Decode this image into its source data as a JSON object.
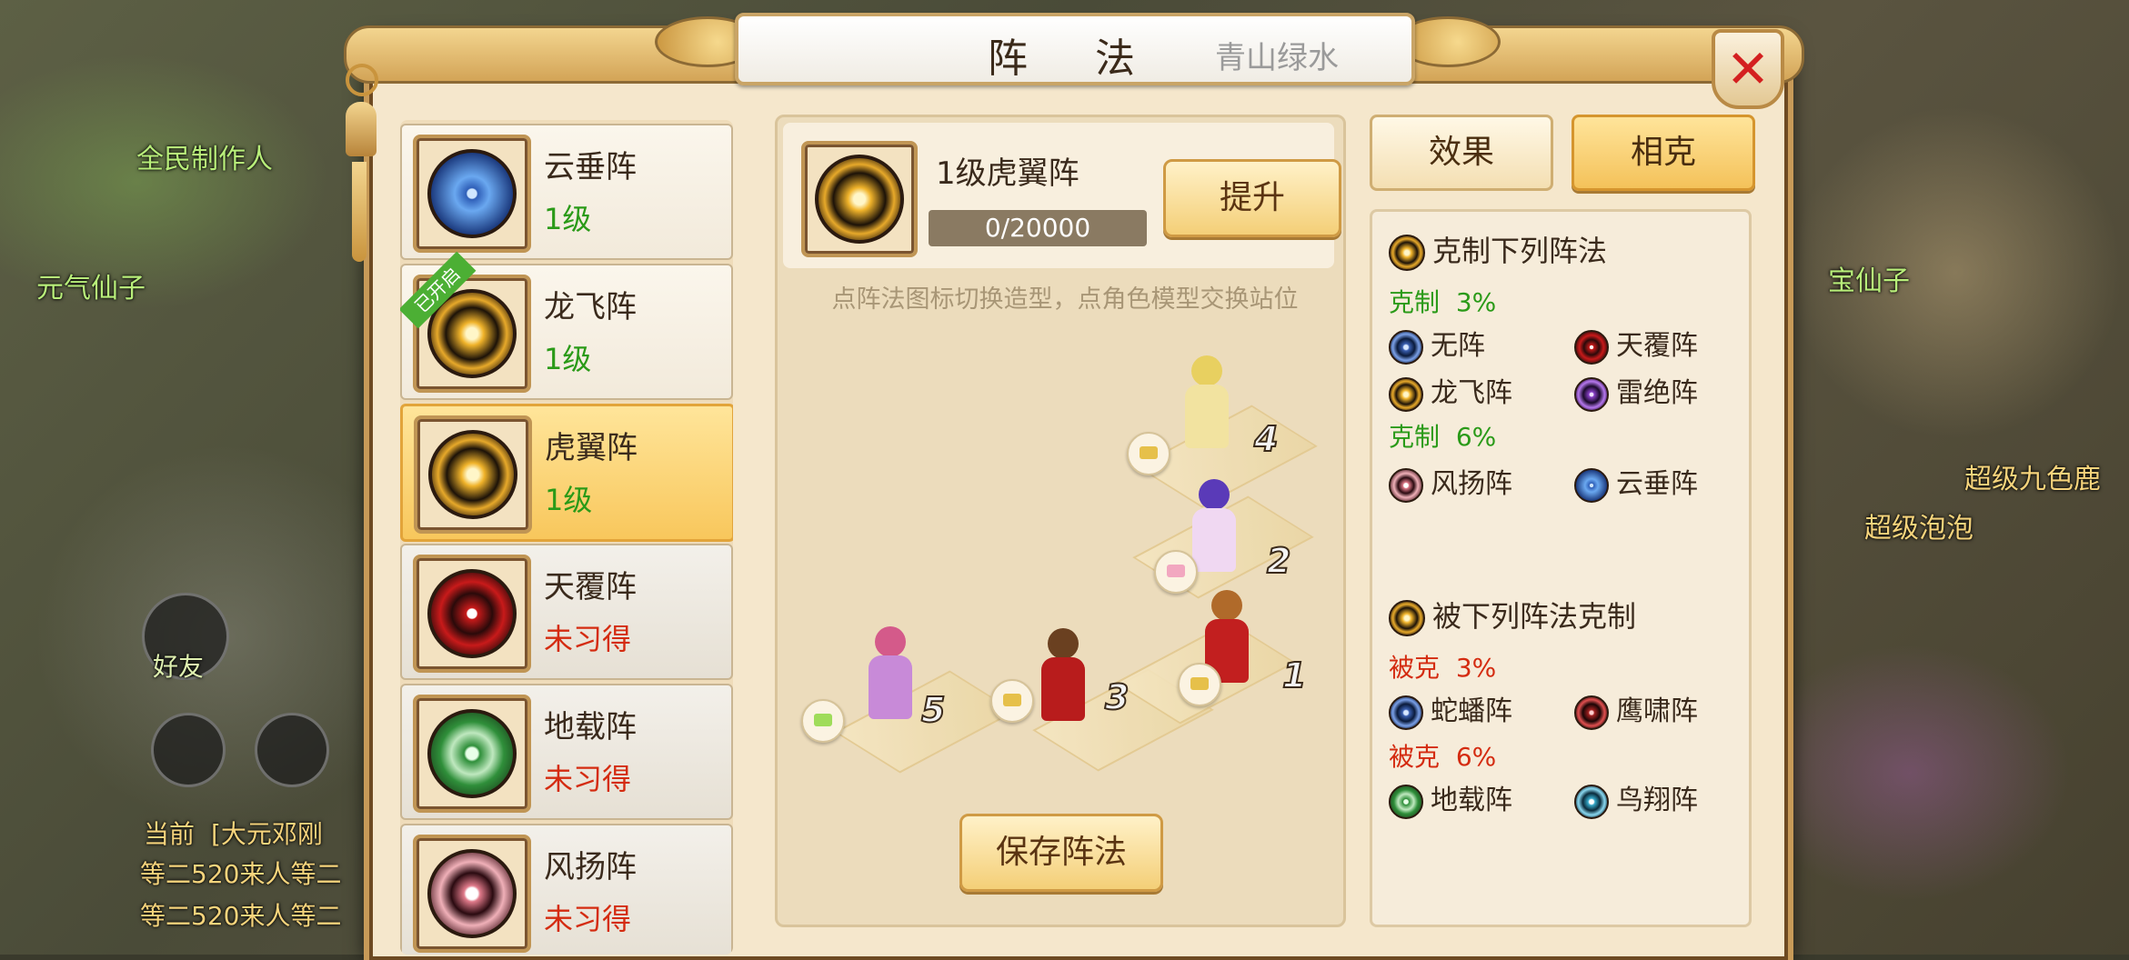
{
  "window": {
    "title": "阵 法",
    "close_icon": "close-icon",
    "title_deco": "青山绿水"
  },
  "background": {
    "labels": [
      "全民制作人",
      "元气仙子",
      "宝仙子",
      "超级九色鹿",
      "超级泡泡",
      "好友",
      "当前",
      "[大元邓刚",
      "等二520来人等二",
      "等二520来人等二"
    ],
    "scene": "game-world"
  },
  "formation_list": [
    {
      "name": "云垂阵",
      "level": "1级",
      "status": "learned",
      "emblem": "blue",
      "icon": "cloud-formation-icon",
      "badge": ""
    },
    {
      "name": "龙飞阵",
      "level": "1级",
      "status": "learned",
      "emblem": "gold",
      "icon": "dragon-formation-icon",
      "badge": "已开启"
    },
    {
      "name": "虎翼阵",
      "level": "1级",
      "status": "learned",
      "emblem": "gold",
      "icon": "tiger-formation-icon",
      "badge": "",
      "selected": true
    },
    {
      "name": "天覆阵",
      "level": "未习得",
      "status": "unlearned",
      "emblem": "red",
      "icon": "heaven-formation-icon",
      "badge": ""
    },
    {
      "name": "地载阵",
      "level": "未习得",
      "status": "unlearned",
      "emblem": "green",
      "icon": "earth-formation-icon",
      "badge": ""
    },
    {
      "name": "风扬阵",
      "level": "未习得",
      "status": "unlearned",
      "emblem": "pink",
      "icon": "wind-formation-icon",
      "badge": ""
    }
  ],
  "current": {
    "name": "1级虎翼阵",
    "progress_text": "0/20000",
    "progress": 0.0,
    "upgrade_label": "提升",
    "hint": "点阵法图标切换造型，点角色模型交换站位",
    "save_label": "保存阵法",
    "slots": [
      "1",
      "2",
      "3",
      "4",
      "5"
    ]
  },
  "tabs": {
    "effect": "效果",
    "counter": "相克",
    "active": "counter"
  },
  "counters": {
    "title": "克制下列阵法",
    "group1": {
      "label": "克制",
      "value": "3%",
      "entries": [
        "无阵",
        "天覆阵",
        "龙飞阵",
        "雷绝阵"
      ]
    },
    "group2": {
      "label": "克制",
      "value": "6%",
      "entries": [
        "风扬阵",
        "云垂阵"
      ]
    }
  },
  "countered_by": {
    "title": "被下列阵法克制",
    "group1": {
      "label": "被克",
      "value": "3%",
      "entries": [
        "蛇蟠阵",
        "鹰啸阵"
      ]
    },
    "group2": {
      "label": "被克",
      "value": "6%",
      "entries": [
        "地载阵",
        "鸟翔阵"
      ]
    }
  },
  "colors": {
    "green_text": "#2a9a18",
    "red_text": "#d42b10",
    "accent_gold": "#f4c25a",
    "close_red": "#d42020"
  }
}
